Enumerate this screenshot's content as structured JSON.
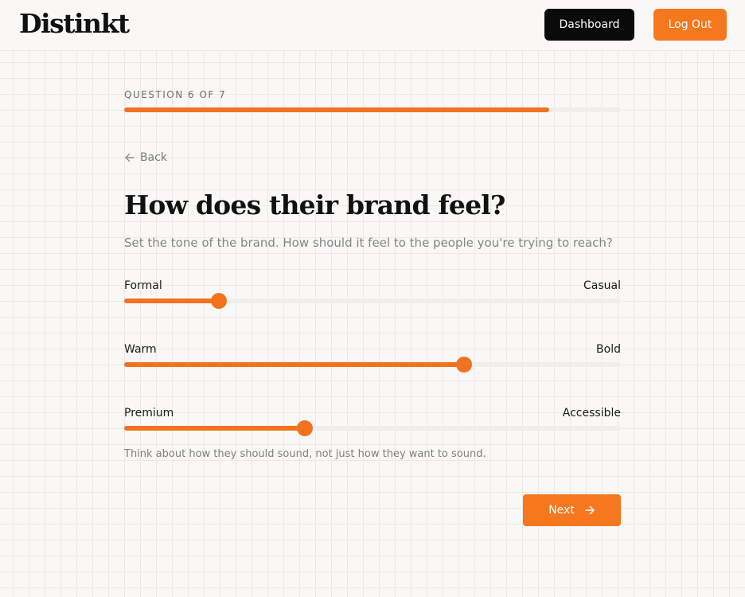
{
  "header": {
    "logo": "Distinkt",
    "dashboard_label": "Dashboard",
    "logout_label": "Log Out"
  },
  "progress": {
    "label": "QUESTION 6 OF 7",
    "fraction": 0.856
  },
  "back_label": "Back",
  "question": {
    "title": "How does their brand feel?",
    "subtitle": "Set the tone of the brand. How should it feel to the people you're trying to reach?"
  },
  "sliders": [
    {
      "left_label": "Formal",
      "right_label": "Casual",
      "value": 0.19
    },
    {
      "left_label": "Warm",
      "right_label": "Bold",
      "value": 0.685
    },
    {
      "left_label": "Premium",
      "right_label": "Accessible",
      "value": 0.363
    }
  ],
  "hint": "Think about how they should sound, not just how they want to sound.",
  "next_label": "Next",
  "colors": {
    "accent": "#f17320",
    "dark_button": "#0a0a0a"
  },
  "icons": {
    "back": "arrow-left-icon",
    "next": "arrow-right-icon"
  }
}
